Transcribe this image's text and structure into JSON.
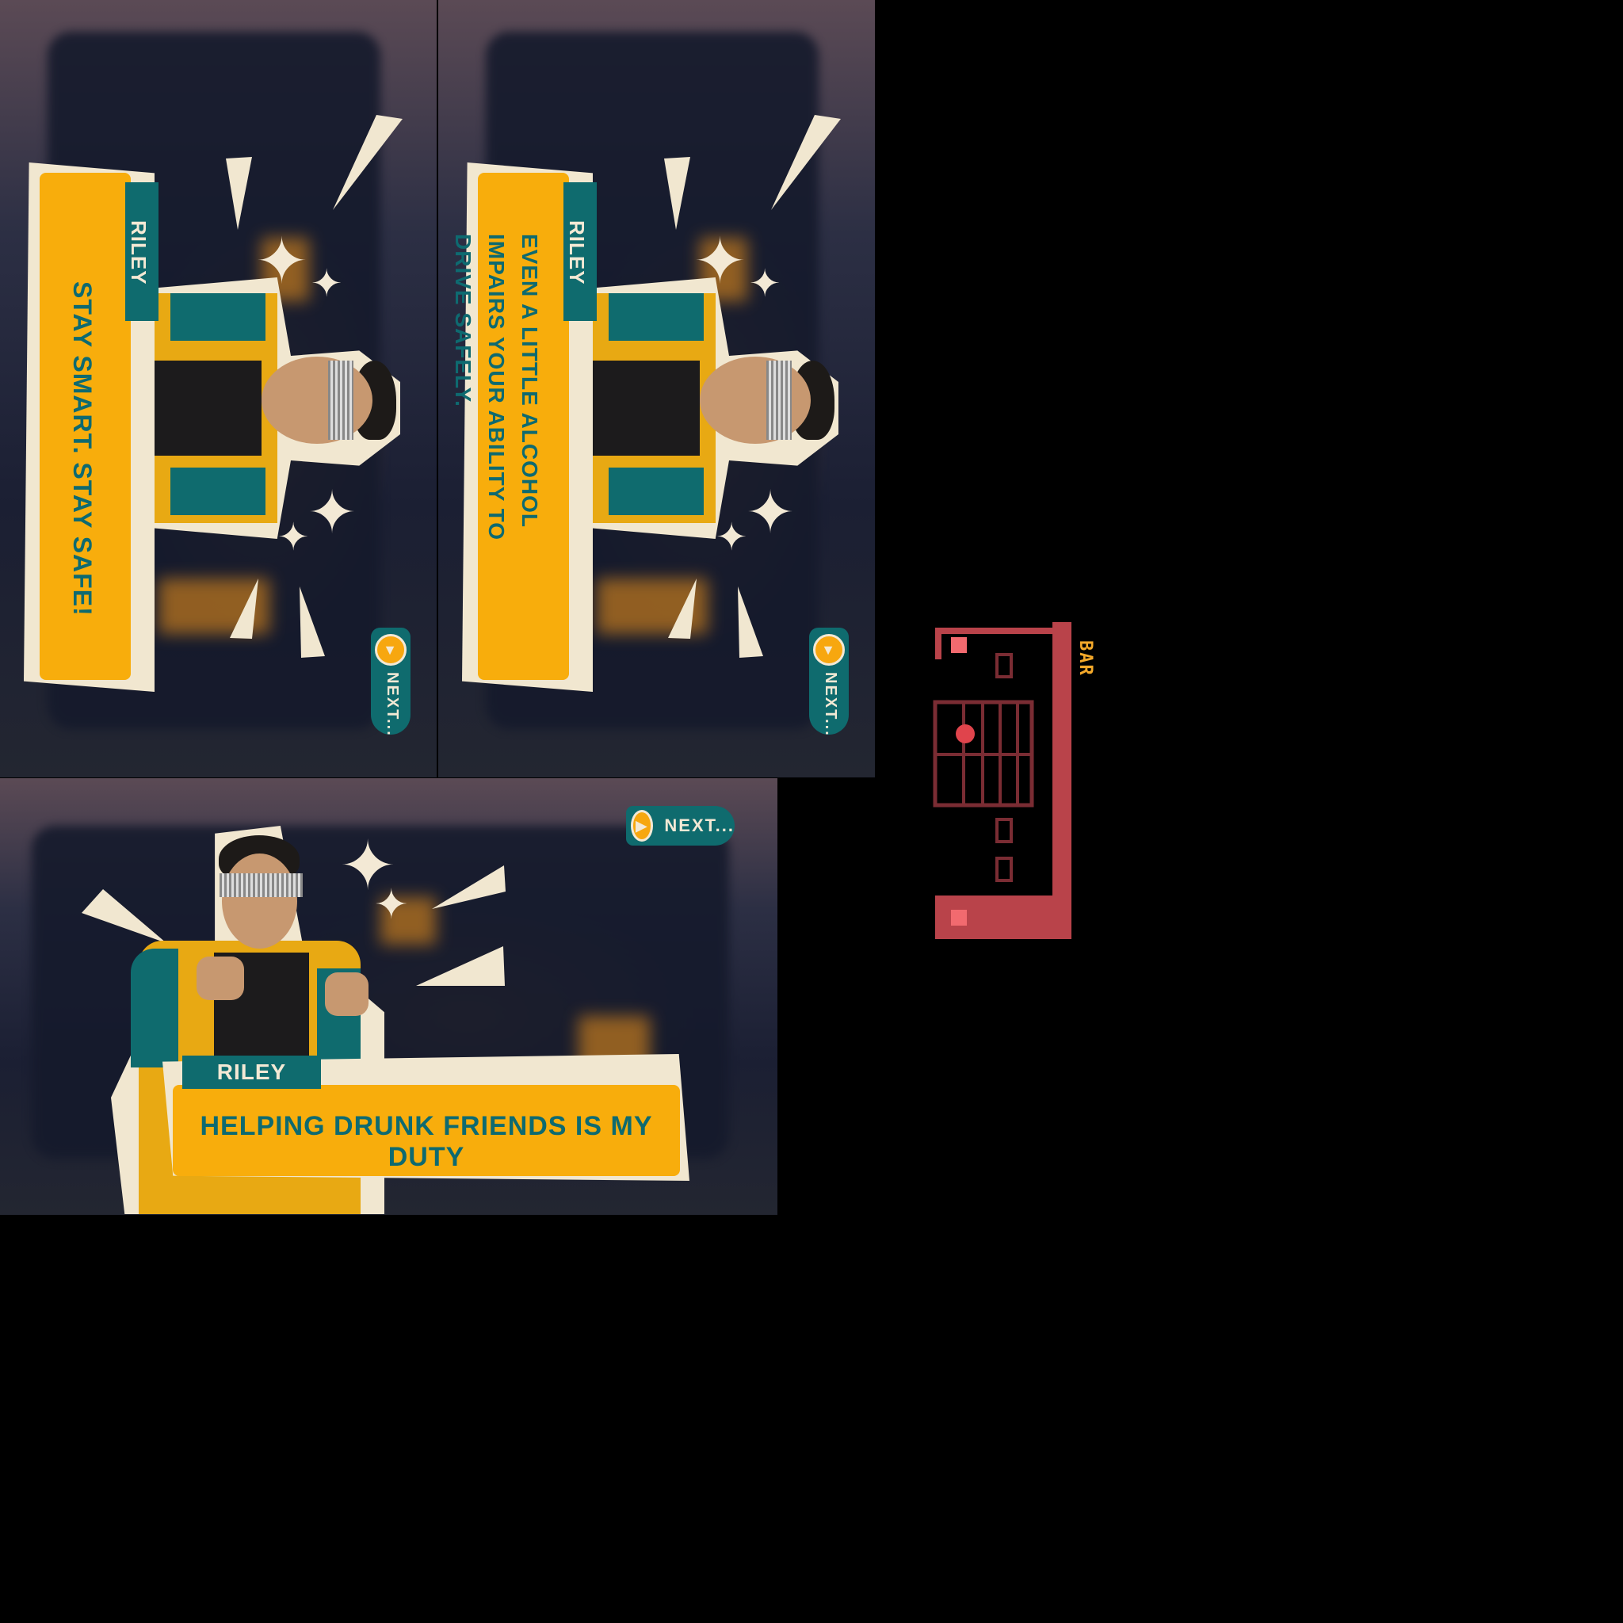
{
  "panels": [
    {
      "speaker": "RILEY",
      "message": "STAY SMART. STAY SAFE!",
      "next_label": "NEXT..."
    },
    {
      "speaker": "RILEY",
      "message": "EVEN A LITTLE ALCOHOL IMPAIRS YOUR ABILITY TO DRIVE SAFELY.",
      "next_label": "NEXT..."
    },
    {
      "speaker": "RILEY",
      "message": "HELPING DRUNK FRIENDS IS MY DUTY",
      "next_label": "NEXT..."
    }
  ],
  "minimap": {
    "label": "BAR"
  },
  "icons": {
    "next": "play-icon",
    "sparkle": "sparkle-icon"
  },
  "colors": {
    "dialog": "#f8ad0c",
    "tag": "#0f6b6e",
    "text": "#0e6a70",
    "paper": "#f1e7d0"
  }
}
